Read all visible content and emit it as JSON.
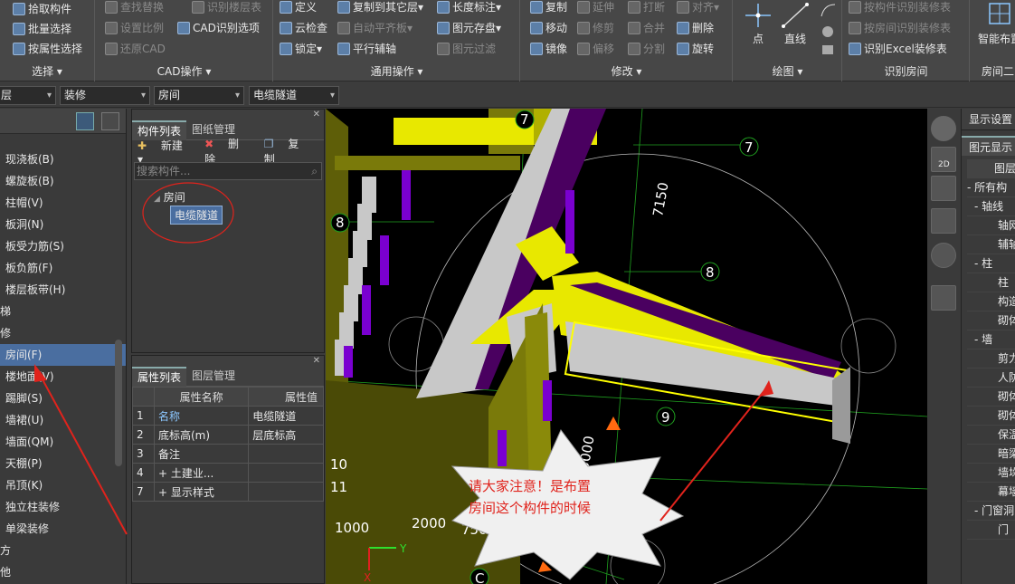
{
  "ribbon": {
    "select_group": {
      "label": "选择",
      "items": [
        "拾取构件",
        "批量选择",
        "按属性选择"
      ]
    },
    "cad_group": {
      "label": "CAD操作",
      "items": [
        "查找替换",
        "识别楼层表",
        "设置比例",
        "CAD识别选项",
        "还原CAD"
      ]
    },
    "common_group": {
      "label": "通用操作",
      "items": [
        "定义",
        "复制到其它层",
        "长度标注",
        "云检查",
        "自动平齐板",
        "图元存盘",
        "锁定",
        "平行辅轴",
        "图元过滤"
      ]
    },
    "modify_group": {
      "label": "修改",
      "items": [
        "复制",
        "延伸",
        "打断",
        "对齐",
        "移动",
        "修剪",
        "合并",
        "删除",
        "镜像",
        "偏移",
        "分割",
        "旋转"
      ]
    },
    "draw_group": {
      "label": "绘图",
      "items": [
        "点",
        "直线"
      ]
    },
    "room_group": {
      "label": "识别房间",
      "items": [
        "按构件识别装修表",
        "按房间识别装修表",
        "识别Excel装修表"
      ]
    },
    "smart_group": {
      "label": "房间二",
      "items": [
        "智能布置"
      ]
    }
  },
  "toolbar2": {
    "dd1": "层",
    "dd2": "装修",
    "dd3": "房间",
    "dd4": "电缆隧道"
  },
  "left_panel": {
    "items": [
      "现浇板(B)",
      "螺旋板(B)",
      "柱帽(V)",
      "板洞(N)",
      "板受力筋(S)",
      "板负筋(F)",
      "楼层板带(H)",
      "梯",
      "修",
      "房间(F)",
      "楼地面(V)",
      "踢脚(S)",
      "墙裙(U)",
      "墙面(QM)",
      "天棚(P)",
      "吊顶(K)",
      "独立柱装修",
      "单梁装修",
      "方",
      "他"
    ],
    "selected": "房间(F)"
  },
  "component_panel": {
    "tabs": [
      "构件列表",
      "图纸管理"
    ],
    "new": "新建",
    "delete": "删除",
    "copy": "复制",
    "search_placeholder": "搜索构件...",
    "tree_root": "房间",
    "tree_child": "电缆隧道"
  },
  "property_panel": {
    "tabs": [
      "属性列表",
      "图层管理"
    ],
    "headers": [
      "属性名称",
      "属性值"
    ],
    "rows": [
      {
        "n": "1",
        "name": "名称",
        "value": "电缆隧道"
      },
      {
        "n": "2",
        "name": "底标高(m)",
        "value": "层底标高"
      },
      {
        "n": "3",
        "name": "备注",
        "value": ""
      },
      {
        "n": "4",
        "name": "+ 土建业...",
        "value": ""
      },
      {
        "n": "7",
        "name": "+ 显示样式",
        "value": ""
      }
    ]
  },
  "viewport": {
    "axis_labels": [
      "7",
      "7",
      "8",
      "8",
      "9",
      "10",
      "11",
      "11",
      "C"
    ],
    "dims": [
      "7150",
      "5000",
      "1000",
      "2000",
      "750"
    ],
    "callout": [
      "请大家注意！是布置",
      "房间这个构件的时候"
    ]
  },
  "right_panel": {
    "title": "显示设置",
    "tab": "图元显示",
    "items": [
      "图层",
      "- 所有构",
      "- 轴线",
      "轴网",
      "辅轴",
      "- 柱",
      "柱",
      "构造",
      "砌体",
      "- 墙",
      "剪力",
      "人防",
      "砌体",
      "砌体",
      "保温",
      "暗梁",
      "墙垛",
      "幕墙",
      "- 门窗洞",
      "门"
    ]
  },
  "colors": {
    "accent": "#4a6ea0",
    "wall_yellow": "#f0f000",
    "room_purple": "#5a0a78",
    "olive": "#7a7a0a",
    "red_annot": "#e0231c"
  }
}
